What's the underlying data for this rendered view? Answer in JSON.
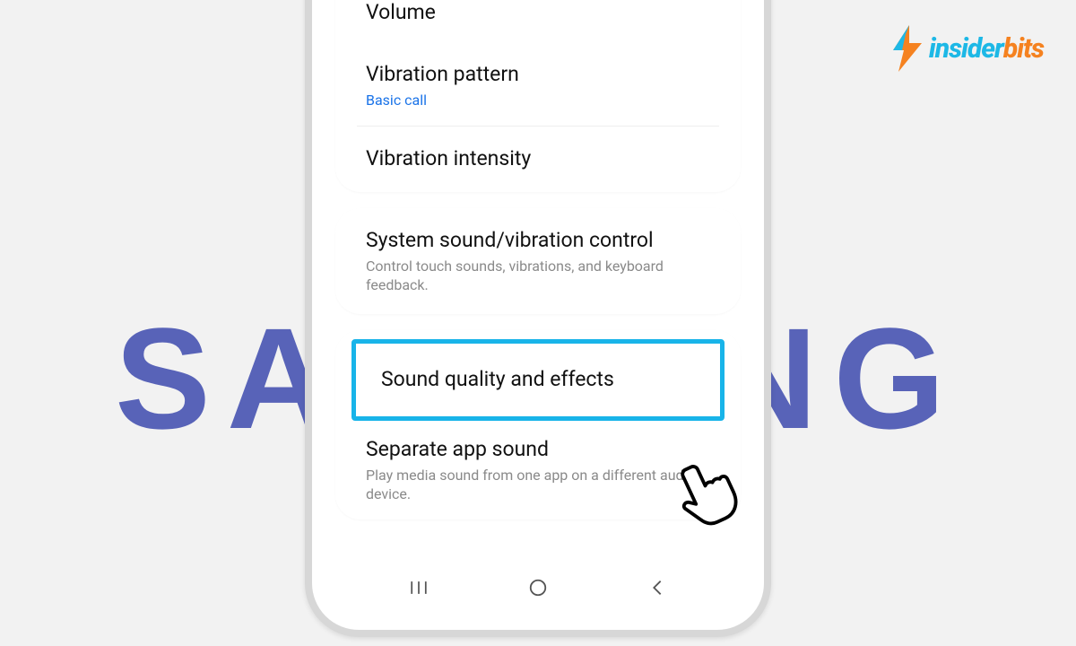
{
  "background": {
    "brand_text": "SAMSUNG"
  },
  "watermark": {
    "text_a": "insider",
    "text_b": "bits",
    "color_a": "#1db8e6",
    "color_b": "#f58220"
  },
  "settings": {
    "group1": {
      "volume": {
        "title": "Volume"
      },
      "vibration_pattern": {
        "title": "Vibration pattern",
        "subtitle": "Basic call"
      },
      "vibration_intensity": {
        "title": "Vibration intensity"
      }
    },
    "group2": {
      "system_sound": {
        "title": "System sound/vibration control",
        "subtitle": "Control touch sounds, vibrations, and keyboard feedback."
      }
    },
    "group3": {
      "sound_quality": {
        "title": "Sound quality and effects"
      },
      "separate_app": {
        "title": "Separate app sound",
        "subtitle": "Play media sound from one app on a different audio device."
      }
    }
  },
  "nav": {
    "recents": "|||",
    "home": "○",
    "back": "<"
  }
}
